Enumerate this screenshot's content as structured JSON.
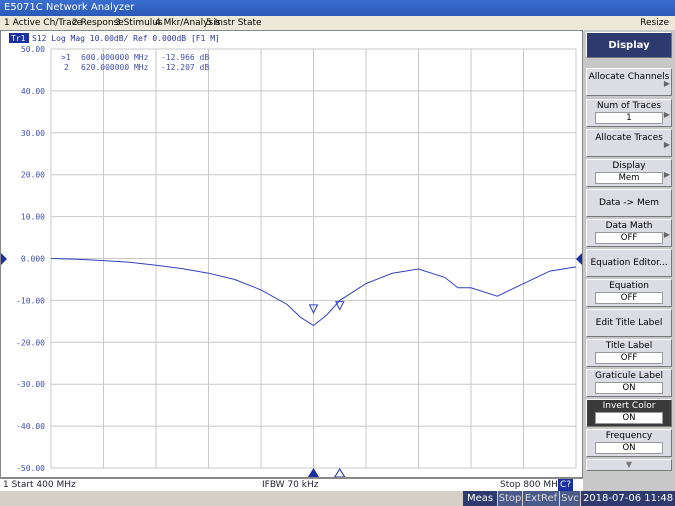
{
  "window": {
    "title": "E5071C Network Analyzer",
    "restore_label": "Resize"
  },
  "menu": [
    {
      "label": "1 Active Ch/Trace"
    },
    {
      "label": "2 Response"
    },
    {
      "label": "3 Stimulus"
    },
    {
      "label": "4 Mkr/Analysis"
    },
    {
      "label": "5 Instr State"
    }
  ],
  "trace_header": {
    "trace": "Tr1",
    "text": "S12  Log Mag  10.00dB/  Ref  0.000dB  [F1 M]"
  },
  "markers": [
    {
      "id": ">1",
      "freq": "600.000000 MHz",
      "value": "-12.966 dB"
    },
    {
      "id": "2",
      "freq": "620.000000 MHz",
      "value": "-12.207 dB"
    }
  ],
  "chart_data": {
    "type": "line",
    "yticks": [
      "50.00",
      "40.00",
      "30.00",
      "20.00",
      "10.00",
      "0.000",
      "-10.00",
      "-20.00",
      "-30.00",
      "-40.00",
      "-50.00"
    ],
    "ylim": [
      -50,
      50
    ],
    "xlim": [
      400,
      800
    ],
    "x": [
      400,
      420,
      440,
      460,
      480,
      500,
      520,
      540,
      560,
      580,
      590,
      600,
      610,
      620,
      640,
      660,
      680,
      700,
      710,
      720,
      740,
      760,
      770,
      780,
      800
    ],
    "series": [
      {
        "values": [
          0,
          -0.2,
          -0.5,
          -0.9,
          -1.6,
          -2.4,
          -3.5,
          -5,
          -7.5,
          -11,
          -14,
          -16,
          -13.5,
          -10,
          -6,
          -3.5,
          -2.5,
          -4.5,
          -7,
          -7,
          -9,
          -6,
          -4.5,
          -3,
          -2
        ]
      }
    ]
  },
  "status": {
    "start": "1  Start 400 MHz",
    "ifbw": "IFBW 70 kHz",
    "stop": "Stop 800 MHz",
    "cal": "C?"
  },
  "footer": {
    "meas": "Meas",
    "stop": "Stop",
    "extref": "ExtRef",
    "svc": "Svc",
    "datetime": "2018-07-06 11:48"
  },
  "softkeys": {
    "header": "Display",
    "allocate_channels": "Allocate Channels",
    "num_traces": "Num of Traces",
    "num_traces_value": "1",
    "allocate_traces": "Allocate Traces",
    "display": "Display",
    "display_value": "Mem",
    "data_mem": "Data -> Mem",
    "data_math": "Data Math",
    "data_math_value": "OFF",
    "equation_editor": "Equation Editor...",
    "equation": "Equation",
    "equation_value": "OFF",
    "edit_title": "Edit Title Label",
    "title_label": "Title Label",
    "title_label_value": "OFF",
    "graticule": "Graticule Label",
    "graticule_value": "ON",
    "invert_color": "Invert Color",
    "invert_color_value": "ON",
    "frequency": "Frequency",
    "frequency_value": "ON"
  }
}
